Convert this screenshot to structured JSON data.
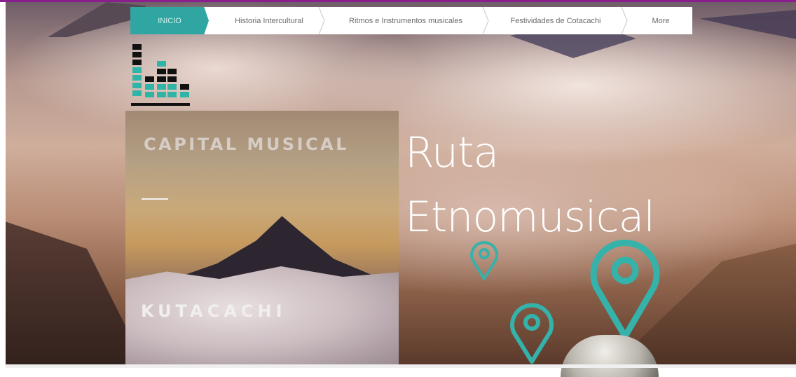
{
  "nav": {
    "items": [
      {
        "label": "INICIO",
        "active": true
      },
      {
        "label": "Historia Intercultural",
        "active": false
      },
      {
        "label": "Ritmos e Instrumentos musicales",
        "active": false
      },
      {
        "label": "Festividades de Cotacachi",
        "active": false
      },
      {
        "label": "More",
        "active": false
      }
    ]
  },
  "logo": {
    "icon": "equalizer-bars-icon"
  },
  "card": {
    "title": "CAPITAL MUSICAL",
    "subtitle": "KUTACACHI"
  },
  "headline": {
    "line1": "Ruta",
    "line2": "Etnomusical"
  },
  "colors": {
    "accent": "#2fa6a2",
    "pin": "#35b2aa",
    "topline": "#8b1e8e",
    "logo_teal": "#2fb5a8"
  },
  "pins": {
    "icon": "map-pin-icon",
    "count": 3
  }
}
